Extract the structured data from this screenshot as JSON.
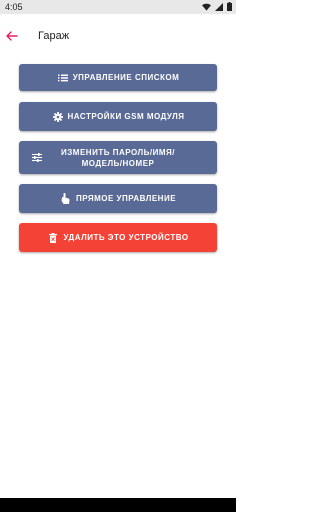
{
  "status_bar": {
    "time": "4:05",
    "icons": [
      "wifi-icon",
      "signal-icon",
      "battery-icon"
    ]
  },
  "toolbar": {
    "title": "Гараж",
    "back_icon": "arrow-left-icon"
  },
  "buttons": [
    {
      "label": "УПРАВЛЕНИЕ СПИСКОМ",
      "icon": "list-icon",
      "color": "#5a6a96"
    },
    {
      "label": "НАСТРОЙКИ GSM МОДУЛЯ",
      "icon": "gear-icon",
      "color": "#5a6a96"
    },
    {
      "label": "ИЗМЕНИТЬ ПАРОЛЬ/ИМЯ/ МОДЕЛЬ/НОМЕР",
      "icon": "tune-icon",
      "color": "#5a6a96"
    },
    {
      "label": "ПРЯМОЕ УПРАВЛЕНИЕ",
      "icon": "touch-icon",
      "color": "#5a6a96"
    },
    {
      "label": "УДАЛИТЬ ЭТО УСТРОЙСТВО",
      "icon": "delete-icon",
      "color": "#f44336"
    }
  ],
  "colors": {
    "accent": "#e91e63",
    "button_primary": "#5a6a96",
    "button_danger": "#f44336",
    "status_bar": "#e8e8e8"
  }
}
